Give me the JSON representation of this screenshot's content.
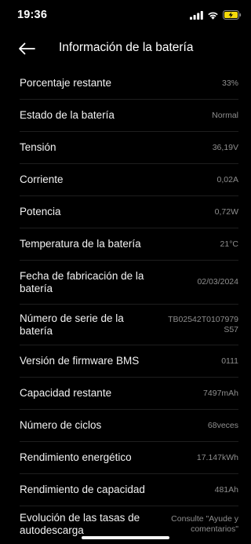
{
  "status_bar": {
    "time": "19:36",
    "icons": [
      "signal-icon",
      "wifi-icon",
      "battery-charging-icon"
    ],
    "battery_color": "#f5d90a"
  },
  "header": {
    "back_icon": "arrow-left-icon",
    "title": "Información de la batería"
  },
  "rows": [
    {
      "label": "Porcentaje restante",
      "value": "33%"
    },
    {
      "label": "Estado de la batería",
      "value": "Normal"
    },
    {
      "label": "Tensión",
      "value": "36,19V"
    },
    {
      "label": "Corriente",
      "value": "0,02A"
    },
    {
      "label": "Potencia",
      "value": "0,72W"
    },
    {
      "label": "Temperatura de la batería",
      "value": "21°C"
    },
    {
      "label": "Fecha de fabricación de la batería",
      "value": "02/03/2024"
    },
    {
      "label": "Número de serie de la batería",
      "value": "TB02542T0107979 S57"
    },
    {
      "label": "Versión de firmware BMS",
      "value": "0111"
    },
    {
      "label": "Capacidad restante",
      "value": "7497mAh"
    },
    {
      "label": "Número de ciclos",
      "value": "68veces"
    },
    {
      "label": "Rendimiento energético",
      "value": "17.147kWh"
    },
    {
      "label": "Rendimiento de capacidad",
      "value": "481Ah"
    },
    {
      "label": "Evolución de las tasas de autodescarga",
      "value": "Consulte \"Ayude y comentarios\""
    }
  ],
  "colors": {
    "background": "#000000",
    "label": "#f2f2f2",
    "value": "#8e8e8e",
    "divider": "#1e1e1e"
  }
}
